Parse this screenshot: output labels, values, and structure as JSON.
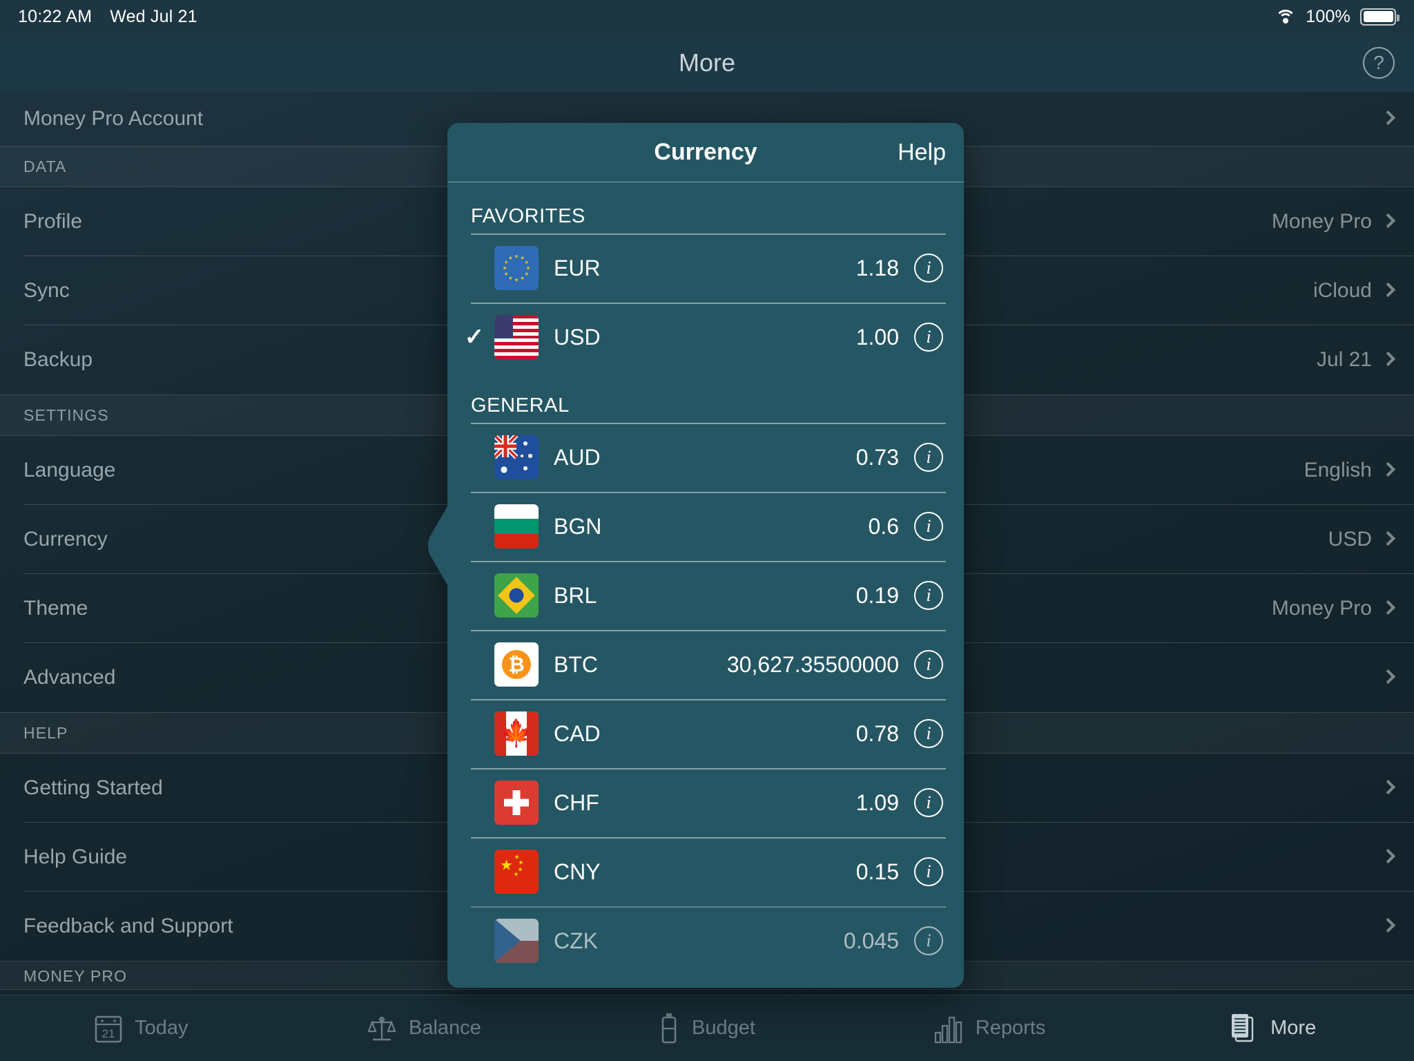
{
  "status_bar": {
    "time": "10:22 AM",
    "date": "Wed Jul 21",
    "wifi_icon": "wifi-icon",
    "battery_percent": "100%",
    "battery_icon": "battery-full-icon"
  },
  "navbar": {
    "title": "More",
    "help_icon": "question-circle-icon"
  },
  "settings_list": {
    "account_row": {
      "label": "Money Pro Account",
      "value": "",
      "chevron": "chevron-right-icon"
    },
    "sections": [
      {
        "header": "DATA",
        "rows": [
          {
            "label": "Profile",
            "value": "Money Pro",
            "chevron": "chevron-right-icon"
          },
          {
            "label": "Sync",
            "value": "iCloud",
            "chevron": "chevron-right-icon"
          },
          {
            "label": "Backup",
            "value": "Jul 21",
            "chevron": "chevron-right-icon"
          }
        ]
      },
      {
        "header": "SETTINGS",
        "rows": [
          {
            "label": "Language",
            "value": "English",
            "chevron": "chevron-right-icon"
          },
          {
            "label": "Currency",
            "value": "USD",
            "chevron": "chevron-right-icon"
          },
          {
            "label": "Theme",
            "value": "Money Pro",
            "chevron": "chevron-right-icon"
          },
          {
            "label": "Advanced",
            "value": "",
            "chevron": "chevron-right-icon"
          }
        ]
      },
      {
        "header": "HELP",
        "rows": [
          {
            "label": "Getting Started",
            "value": "",
            "chevron": "chevron-right-icon"
          },
          {
            "label": "Help Guide",
            "value": "",
            "chevron": "chevron-right-icon"
          },
          {
            "label": "Feedback and Support",
            "value": "",
            "chevron": "chevron-right-icon"
          }
        ]
      }
    ],
    "trailing_header": "MONEY PRO"
  },
  "tabbar": {
    "tabs": [
      {
        "label": "Today",
        "icon": "calendar-21-icon",
        "active": false
      },
      {
        "label": "Balance",
        "icon": "scales-icon",
        "active": false
      },
      {
        "label": "Budget",
        "icon": "battery-icon",
        "active": false
      },
      {
        "label": "Reports",
        "icon": "bar-chart-icon",
        "active": false
      },
      {
        "label": "More",
        "icon": "documents-icon",
        "active": true
      }
    ]
  },
  "currency_popover": {
    "title": "Currency",
    "help_label": "Help",
    "info_icon": "info-circle-icon",
    "check_icon": "checkmark-icon",
    "groups": [
      {
        "header": "FAVORITES",
        "items": [
          {
            "code": "EUR",
            "rate": "1.18",
            "selected": false,
            "flag": "flag-eu"
          },
          {
            "code": "USD",
            "rate": "1.00",
            "selected": true,
            "flag": "flag-us"
          }
        ]
      },
      {
        "header": "GENERAL",
        "items": [
          {
            "code": "AUD",
            "rate": "0.73",
            "selected": false,
            "flag": "flag-au"
          },
          {
            "code": "BGN",
            "rate": "0.6",
            "selected": false,
            "flag": "flag-bg"
          },
          {
            "code": "BRL",
            "rate": "0.19",
            "selected": false,
            "flag": "flag-br"
          },
          {
            "code": "BTC",
            "rate": "30,627.35500000",
            "selected": false,
            "flag": "flag-btc"
          },
          {
            "code": "CAD",
            "rate": "0.78",
            "selected": false,
            "flag": "flag-ca"
          },
          {
            "code": "CHF",
            "rate": "1.09",
            "selected": false,
            "flag": "flag-ch"
          },
          {
            "code": "CNY",
            "rate": "0.15",
            "selected": false,
            "flag": "flag-cn"
          },
          {
            "code": "CZK",
            "rate": "0.045",
            "selected": false,
            "flag": "flag-cz"
          }
        ]
      }
    ]
  },
  "colors": {
    "app_background": "#16272f",
    "navbar": "#1e3946",
    "popover": "#255663",
    "text_primary": "#ffffff",
    "text_secondary": "#9fadb3"
  }
}
